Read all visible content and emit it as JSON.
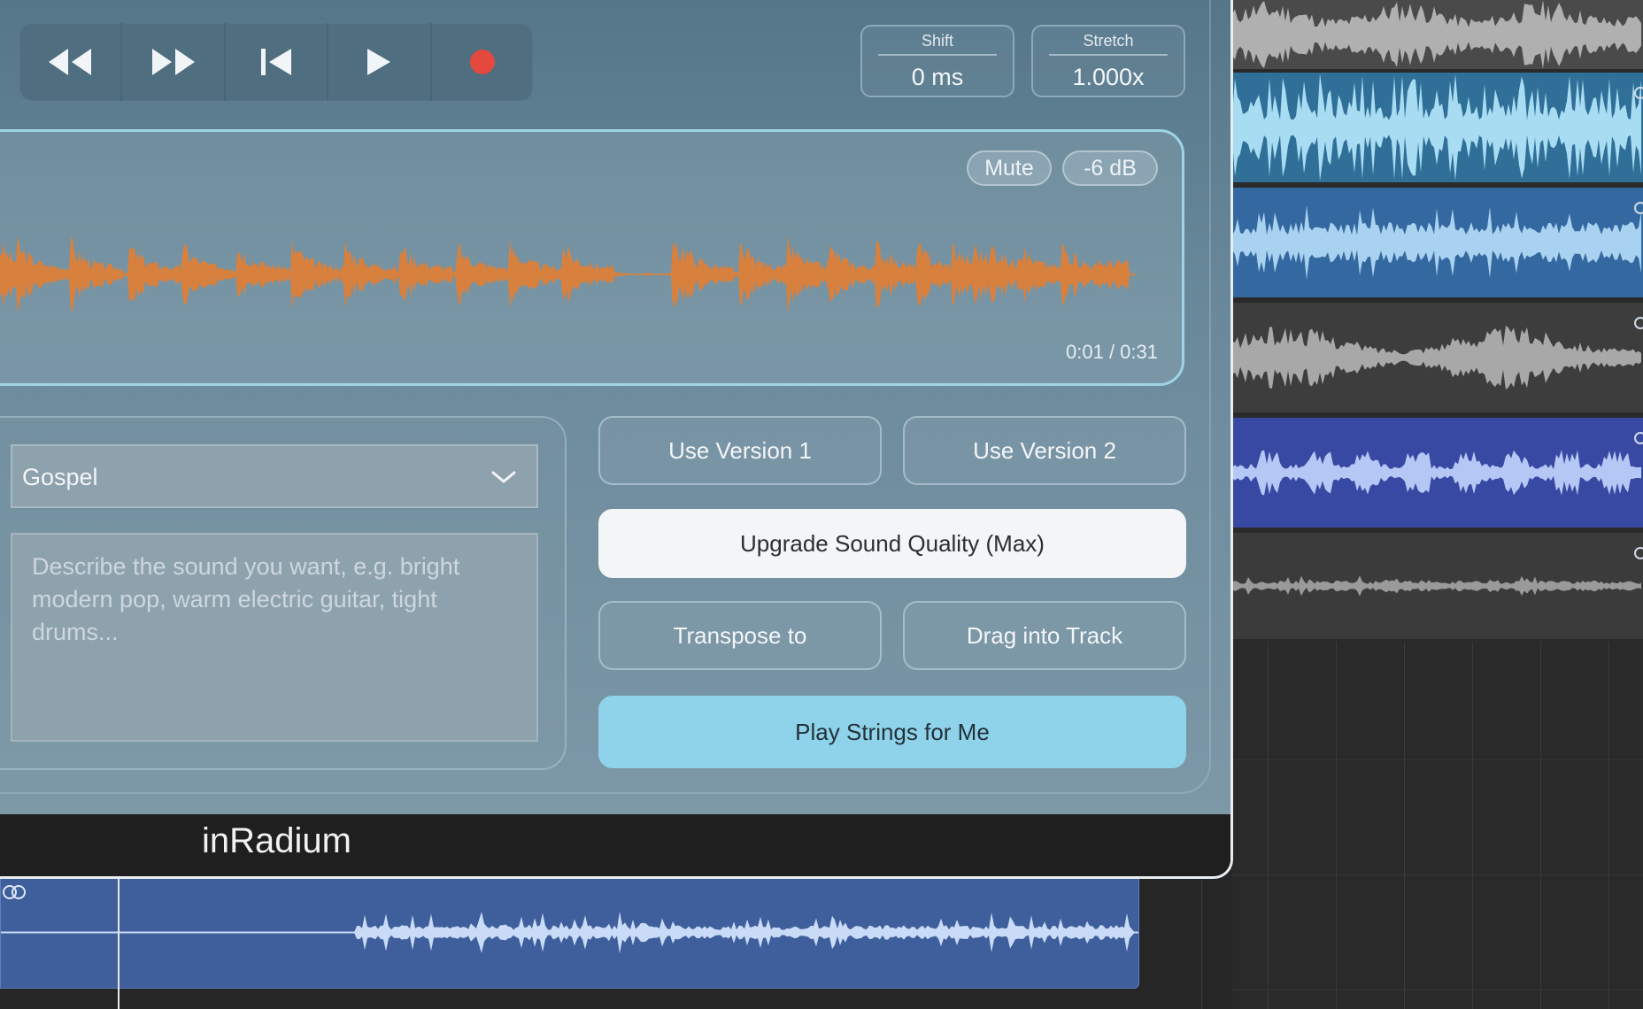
{
  "plugin": {
    "title": "inRadium",
    "transport": {
      "rewind_icon": "rewind-icon",
      "fast_forward_icon": "fast-forward-icon",
      "skip_back_icon": "skip-to-start-icon",
      "play_icon": "play-icon",
      "record_icon": "record-icon",
      "record_color": "#e5483f"
    },
    "shift": {
      "label": "Shift",
      "value": "0 ms"
    },
    "stretch": {
      "label": "Stretch",
      "value": "1.000x"
    },
    "waveform": {
      "mute_label": "Mute",
      "gain_label": "-6 dB",
      "time": "0:01 / 0:31",
      "wave_color": "#d8803e"
    },
    "genre": {
      "selected": "Gospel"
    },
    "prompt": {
      "placeholder": "Describe the sound you want, e.g. bright modern pop, warm electric guitar, tight drums..."
    },
    "actions": {
      "use_version_1": "Use Version 1",
      "use_version_2": "Use Version 2",
      "upgrade": "Upgrade Sound Quality (Max)",
      "transpose": "Transpose to",
      "drag": "Drag into Track",
      "play_strings": "Play Strings for Me"
    },
    "colors": {
      "accent": "#8fd3ea",
      "panel": "#6a8a9c",
      "upgrade_bg": "#f3f5f6"
    }
  },
  "daw": {
    "tracks": [
      {
        "color": "#4a4a4a",
        "wave": "#b0b0b0"
      },
      {
        "color": "#2f6f98",
        "wave": "#a8dcf2"
      },
      {
        "color": "#3468a0",
        "wave": "#a9d2f0"
      },
      {
        "color": "#3d3d3d",
        "wave": "#a8a8a8"
      },
      {
        "color": "#3849a3",
        "wave": "#b5c8f5"
      },
      {
        "color": "#3b3b3b",
        "wave": "#9a9a9a"
      }
    ],
    "bottom_region": {
      "color": "#3e5f9c",
      "wave": "#c9dbf7",
      "loop_icon": "loop-icon"
    }
  }
}
